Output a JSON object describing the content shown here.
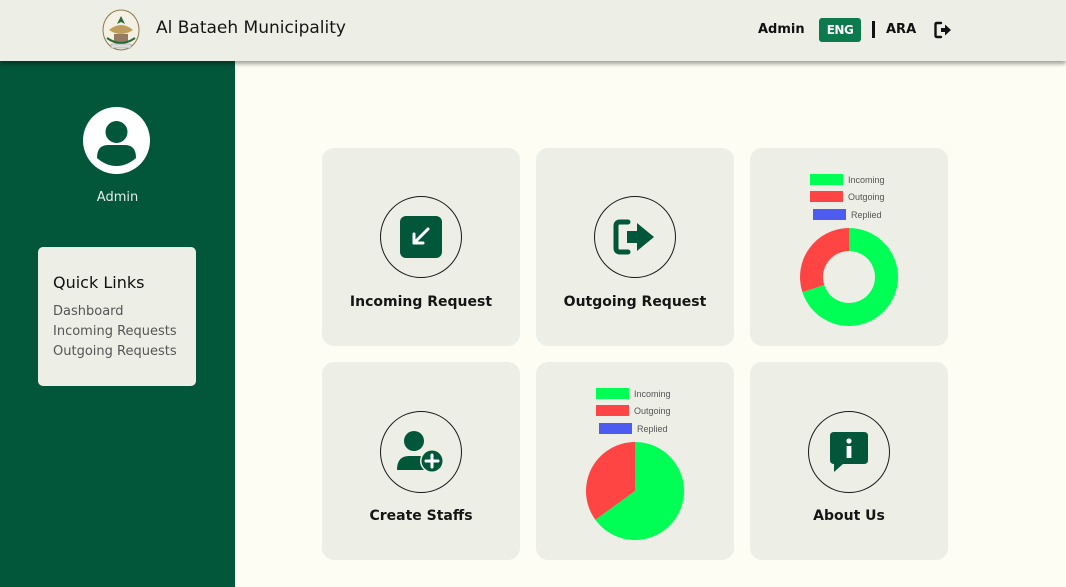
{
  "header": {
    "title": "Al Bataeh Municipality",
    "user": "Admin",
    "lang_eng": "ENG",
    "lang_ara": "ARA",
    "logout_icon": "logout-icon"
  },
  "sidebar": {
    "user": "Admin",
    "quick_links": {
      "title": "Quick Links",
      "items": [
        "Dashboard",
        "Incoming Requests",
        "Outgoing Requests"
      ]
    }
  },
  "cards": {
    "incoming": {
      "label": "Incoming Request",
      "icon": "arrow-down-left-icon"
    },
    "outgoing": {
      "label": "Outgoing Request",
      "icon": "arrow-right-icon"
    },
    "create_staffs": {
      "label": "Create Staffs",
      "icon": "add-user-icon"
    },
    "about": {
      "label": "About Us",
      "icon": "info-icon"
    }
  },
  "colors": {
    "primary": "#02563a",
    "accent": "#0c7a4c",
    "incoming": "#00ff55",
    "outgoing": "#ff4444",
    "replied": "#4e5bf0"
  },
  "chart_data": [
    {
      "type": "pie",
      "variant": "doughnut",
      "legend": [
        "Incoming",
        "Outgoing",
        "Replied"
      ],
      "values": [
        70,
        30,
        0
      ],
      "legend_position": "top"
    },
    {
      "type": "pie",
      "legend": [
        "Incoming",
        "Outgoing",
        "Replied"
      ],
      "values": [
        65,
        35,
        0
      ],
      "legend_position": "top"
    }
  ]
}
